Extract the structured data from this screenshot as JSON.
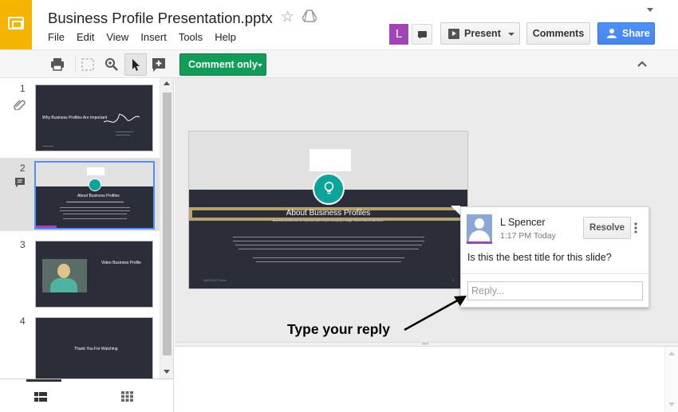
{
  "app": {
    "doc_title": "Business Profile Presentation.pptx",
    "logo_icon": "slides-logo-icon",
    "accent": "#f4b400"
  },
  "menu": [
    "File",
    "Edit",
    "View",
    "Insert",
    "Tools",
    "Help"
  ],
  "header_actions": {
    "user_initial": "L",
    "present_label": "Present",
    "comments_label": "Comments",
    "share_label": "Share",
    "share_color": "#4d90fe"
  },
  "toolbar": {
    "mode_label": "Comment only",
    "mode_color": "#0f9d58"
  },
  "filmstrip": {
    "slides": [
      {
        "number": "1",
        "title": "Why Business Profiles Are Important"
      },
      {
        "number": "2",
        "title": "About Business Profiles"
      },
      {
        "number": "3",
        "title": "Video Business Profile"
      },
      {
        "number": "4",
        "title": "Thank You For Watching"
      }
    ],
    "selected_index": 2
  },
  "slide": {
    "title": "About Business Profiles",
    "subtitle": "Business profiles are an important part of your company's image. Here's how to use them.",
    "footer": "SIMPLIGO Theme",
    "page": "2"
  },
  "comment": {
    "author": "L Spencer",
    "time": "1:17 PM Today",
    "text": "Is this the best title for this slide?",
    "resolve_label": "Resolve",
    "reply_placeholder": "Reply..."
  },
  "annotation": {
    "text": "Type your reply"
  }
}
